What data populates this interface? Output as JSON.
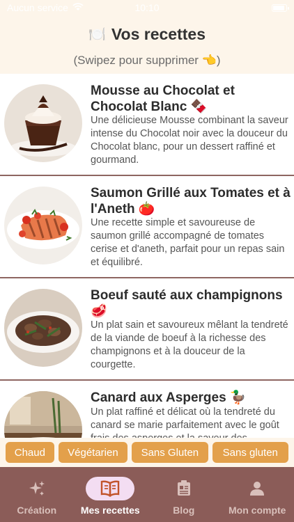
{
  "status_bar": {
    "carrier": "Aucun service",
    "time": "10:10"
  },
  "header": {
    "title": "Vos recettes",
    "title_icon": "🍽️",
    "subtitle": "(Swipez pour supprimer 👈)"
  },
  "recipes": [
    {
      "title": "Mousse au Chocolat et Chocolat Blanc 🍫",
      "description": "Une délicieuse Mousse combinant la saveur intense du Chocolat noir avec la douceur du Chocolat blanc, pour un dessert raffiné et gourmand."
    },
    {
      "title": "Saumon Grillé aux Tomates et à l'Aneth 🍅",
      "description": "Une recette simple et savoureuse de saumon grillé accompagné de tomates cerise et d'aneth, parfait pour un repas sain et équilibré."
    },
    {
      "title": "Boeuf sauté aux champignons 🥩",
      "description": "Un plat sain et savoureux mêlant la tendreté de la viande de boeuf à la richesse des champignons et à la douceur de la courgette."
    },
    {
      "title": "Canard aux Asperges 🦆",
      "description": "Un plat raffiné et délicat où la tendreté du canard se marie parfaitement avec le goût frais des asperges et la saveur des"
    }
  ],
  "filters": [
    "Chaud",
    "Végétarien",
    "Sans Gluten",
    "Sans gluten"
  ],
  "tabs": [
    {
      "label": "Création",
      "icon": "sparkles-icon"
    },
    {
      "label": "Mes recettes",
      "icon": "open-book-icon"
    },
    {
      "label": "Blog",
      "icon": "newspaper-icon"
    },
    {
      "label": "Mon compte",
      "icon": "person-icon"
    }
  ],
  "colors": {
    "accent": "#e3a04b",
    "tabbar": "#8b5c58",
    "active_pill": "#f3ddf2",
    "header_bg": "#fdf5ea"
  }
}
